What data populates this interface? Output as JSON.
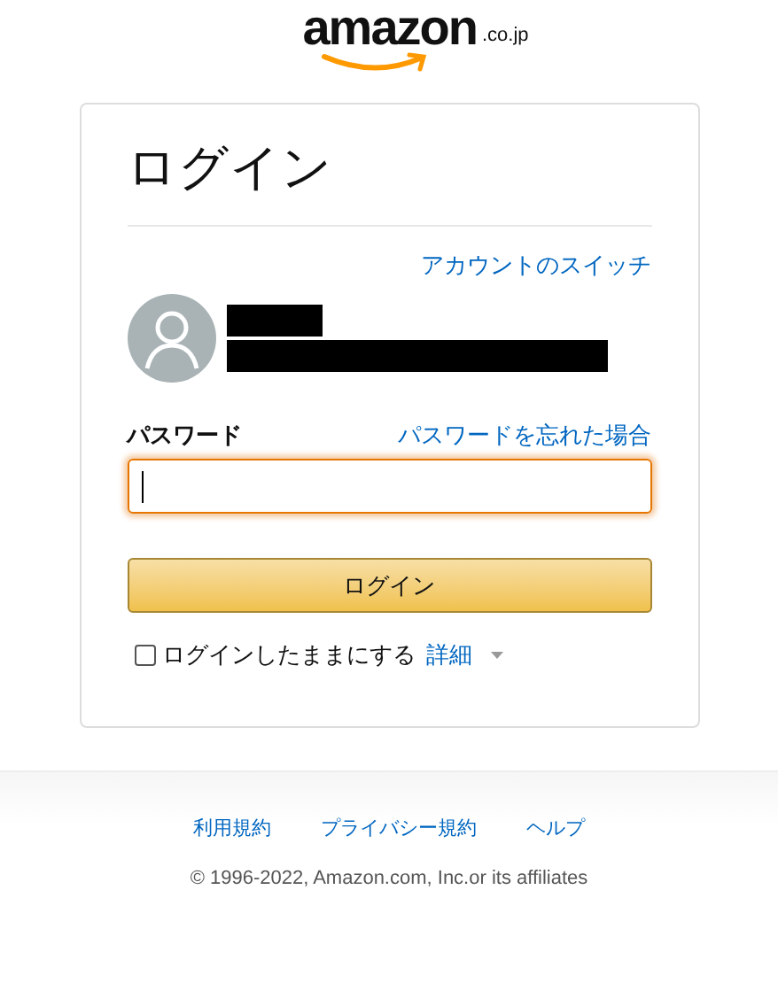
{
  "logo": {
    "wordmark": "amazon",
    "suffix": ".co.jp"
  },
  "card": {
    "title": "ログイン",
    "switch_account": "アカウントのスイッチ",
    "password": {
      "label": "パスワード",
      "forgot": "パスワードを忘れた場合",
      "focused": true
    },
    "submit": "ログイン",
    "remember": {
      "label": "ログインしたままにする",
      "checked": false
    },
    "details": "詳細"
  },
  "footer": {
    "links": [
      "利用規約",
      "プライバシー規約",
      "ヘルプ"
    ],
    "copyright": "© 1996-2022, Amazon.com, Inc.or its affiliates"
  }
}
